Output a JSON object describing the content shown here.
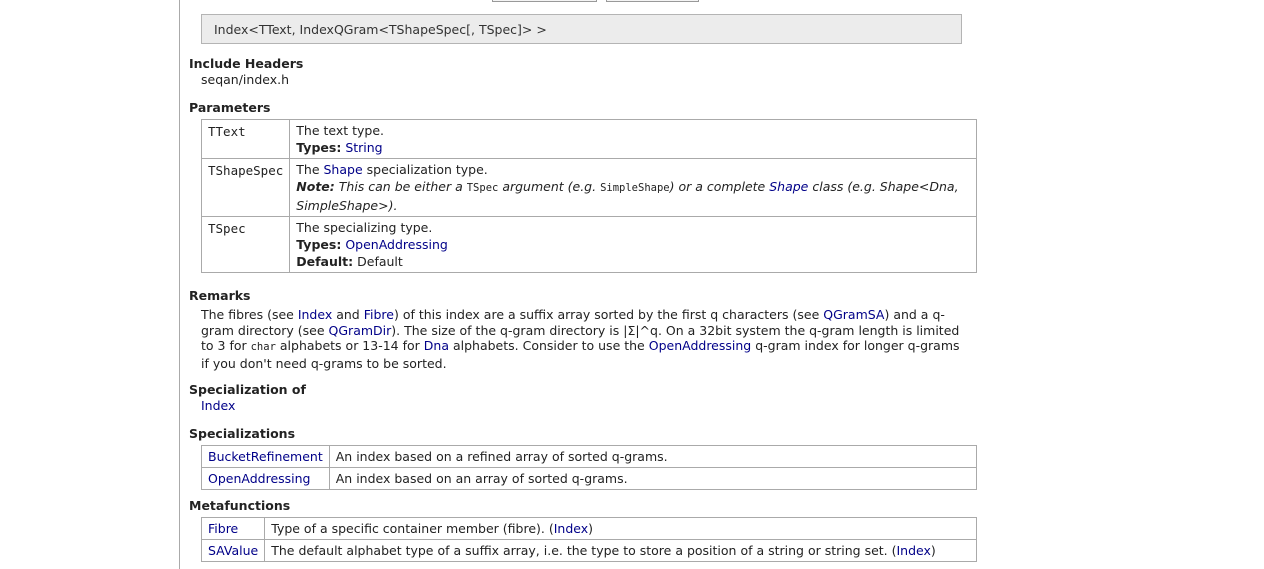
{
  "signature": "Index<TText, IndexQGram<TShapeSpec[, TSpec]> >",
  "include_headers": {
    "heading": "Include Headers",
    "value": "seqan/index.h"
  },
  "parameters": {
    "heading": "Parameters",
    "ttext": {
      "name": "TText",
      "desc": "The text type.",
      "types_label": "Types:",
      "types_link": "String"
    },
    "tshapespec": {
      "name": "TShapeSpec",
      "desc_pre": "The ",
      "desc_link": "Shape",
      "desc_post": " specialization type.",
      "note_label": "Note:",
      "note_1": " This can be either a ",
      "note_code_1": "TSpec",
      "note_2": " argument (e.g. ",
      "note_code_2": "SimpleShape",
      "note_3": ") or a complete ",
      "note_link": "Shape",
      "note_4": " class (e.g. Shape<Dna, SimpleShape>)."
    },
    "tspec": {
      "name": "TSpec",
      "desc": "The specializing type.",
      "types_label": "Types:",
      "types_link": "OpenAddressing",
      "default_label": "Default:",
      "default_value": " Default"
    }
  },
  "remarks": {
    "heading": "Remarks",
    "t1": "The fibres (see ",
    "l1": "Index",
    "t2": " and ",
    "l2": "Fibre",
    "t3": ") of this index are a suffix array sorted by the first q characters (see ",
    "l3": "QGramSA",
    "t4": ") and a q-gram directory (see ",
    "l4": "QGramDir",
    "t5": "). The size of the q-gram directory is |Σ|^q. On a 32bit system the q-gram length is limited to 3 for ",
    "c1": "char",
    "t6": " alphabets or 13-14 for ",
    "l5": "Dna",
    "t7": " alphabets. Consider to use the ",
    "l6": "OpenAddressing",
    "t8": " q-gram index for longer q-grams if you don't need q-grams to be sorted."
  },
  "specialization_of": {
    "heading": "Specialization of",
    "link": "Index"
  },
  "specializations": {
    "heading": "Specializations",
    "rows": [
      {
        "name": "BucketRefinement",
        "desc": "An index based on a refined array of sorted q-grams."
      },
      {
        "name": "OpenAddressing",
        "desc": "An index based on an array of sorted q-grams."
      }
    ]
  },
  "metafunctions": {
    "heading": "Metafunctions",
    "rows": [
      {
        "name": "Fibre",
        "desc": "Type of a specific container member (fibre). (",
        "link": "Index",
        "tail": ")"
      },
      {
        "name": "SAValue",
        "desc": "The default alphabet type of a suffix array, i.e. the type to store a position of a string or string set. (",
        "link": "Index",
        "tail": ")"
      }
    ]
  }
}
